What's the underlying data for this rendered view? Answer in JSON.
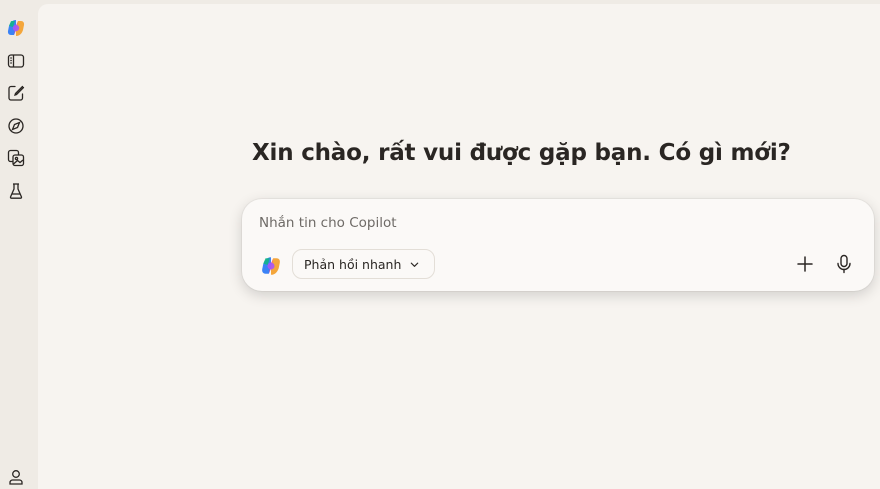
{
  "sidebar": {
    "items": [
      {
        "icon": "copilot-logo-icon"
      },
      {
        "icon": "sidebar-toggle-icon"
      },
      {
        "icon": "new-chat-icon"
      },
      {
        "icon": "discover-icon"
      },
      {
        "icon": "image-gallery-icon"
      },
      {
        "icon": "labs-flask-icon"
      },
      {
        "icon": "user-profile-icon"
      }
    ]
  },
  "main": {
    "greeting": "Xin chào, rất vui được gặp bạn. Có gì mới?"
  },
  "composer": {
    "placeholder": "Nhắn tin cho Copilot",
    "mode_label": "Phản hồi nhanh",
    "add_icon": "plus-icon",
    "mic_icon": "microphone-icon"
  },
  "colors": {
    "sidebar_bg": "#efebe5",
    "main_bg": "#f7f4f0",
    "composer_bg": "#fbf9f7",
    "text": "#2a2623"
  }
}
